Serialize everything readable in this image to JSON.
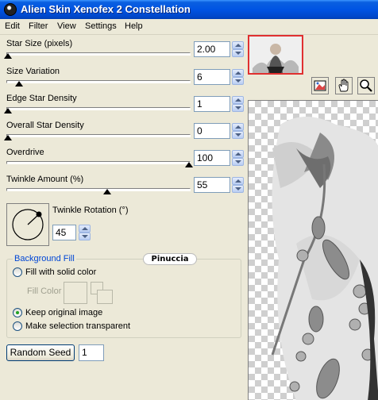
{
  "window": {
    "title": "Alien Skin Xenofex 2 Constellation"
  },
  "menu": [
    "Edit",
    "Filter",
    "View",
    "Settings",
    "Help"
  ],
  "sliders": [
    {
      "label": "Star Size (pixels)",
      "value": "2.00",
      "level": 0.0
    },
    {
      "label": "Size Variation",
      "value": "6",
      "level": 0.06
    },
    {
      "label": "Edge Star Density",
      "value": "1",
      "level": 0.0
    },
    {
      "label": "Overall Star Density",
      "value": "0",
      "level": 0.0
    },
    {
      "label": "Overdrive",
      "value": "100",
      "level": 1.0
    },
    {
      "label": "Twinkle Amount (%)",
      "value": "55",
      "level": 0.55
    }
  ],
  "rotation": {
    "label": "Twinkle Rotation (°)",
    "value": "45"
  },
  "background_fill": {
    "legend": "Background Fill",
    "watermark": "Pinuccia",
    "options": [
      {
        "label": "Fill with solid color",
        "checked": false
      },
      {
        "label": "Keep original image",
        "checked": true
      },
      {
        "label": "Make selection transparent",
        "checked": false
      }
    ],
    "fill_color_label": "Fill Color"
  },
  "random_seed": {
    "button_label": "Random Seed",
    "value": "1"
  },
  "tools": [
    "preview-toggle-icon",
    "hand-icon",
    "zoom-icon"
  ],
  "colors": {
    "titlebar": "#0054e3",
    "thumb_border": "#e03030",
    "panel": "#ece9d8"
  }
}
